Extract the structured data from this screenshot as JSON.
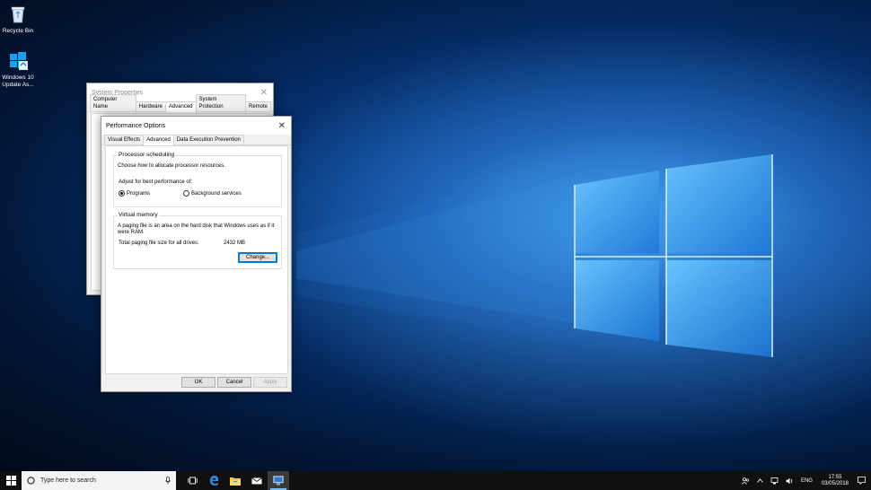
{
  "desktop": {
    "icons": [
      {
        "label": "Recycle Bin",
        "icon": "recycle-bin-icon"
      },
      {
        "label": "Windows 10 Update As...",
        "icon": "windows-update-assistant-icon"
      }
    ]
  },
  "system_properties": {
    "title": "System Properties",
    "tabs": [
      "Computer Name",
      "Hardware",
      "Advanced",
      "System Protection",
      "Remote"
    ],
    "active_tab": "Advanced"
  },
  "performance_options": {
    "title": "Performance Options",
    "tabs": [
      "Visual Effects",
      "Advanced",
      "Data Execution Prevention"
    ],
    "active_tab": "Advanced",
    "processor_scheduling": {
      "legend": "Processor scheduling",
      "description": "Choose how to allocate processor resources.",
      "adjust_label": "Adjust for best performance of:",
      "options": [
        "Programs",
        "Background services"
      ],
      "selected": "Programs"
    },
    "virtual_memory": {
      "legend": "Virtual memory",
      "description_line1": "A paging file is an area on the hard disk that Windows uses as if it",
      "description_line2": "were RAM.",
      "total_label": "Total paging file size for all drives:",
      "total_value": "2432 MB",
      "change_button": "Change..."
    },
    "buttons": {
      "ok": "OK",
      "cancel": "Cancel",
      "apply": "Apply"
    }
  },
  "taskbar": {
    "search_placeholder": "Type here to search",
    "language": "ENG",
    "time": "17:55",
    "date": "03/05/2018"
  },
  "colors": {
    "accent": "#0078d7",
    "taskbar": "#101010",
    "wallpaper": "#0c4aa0"
  }
}
